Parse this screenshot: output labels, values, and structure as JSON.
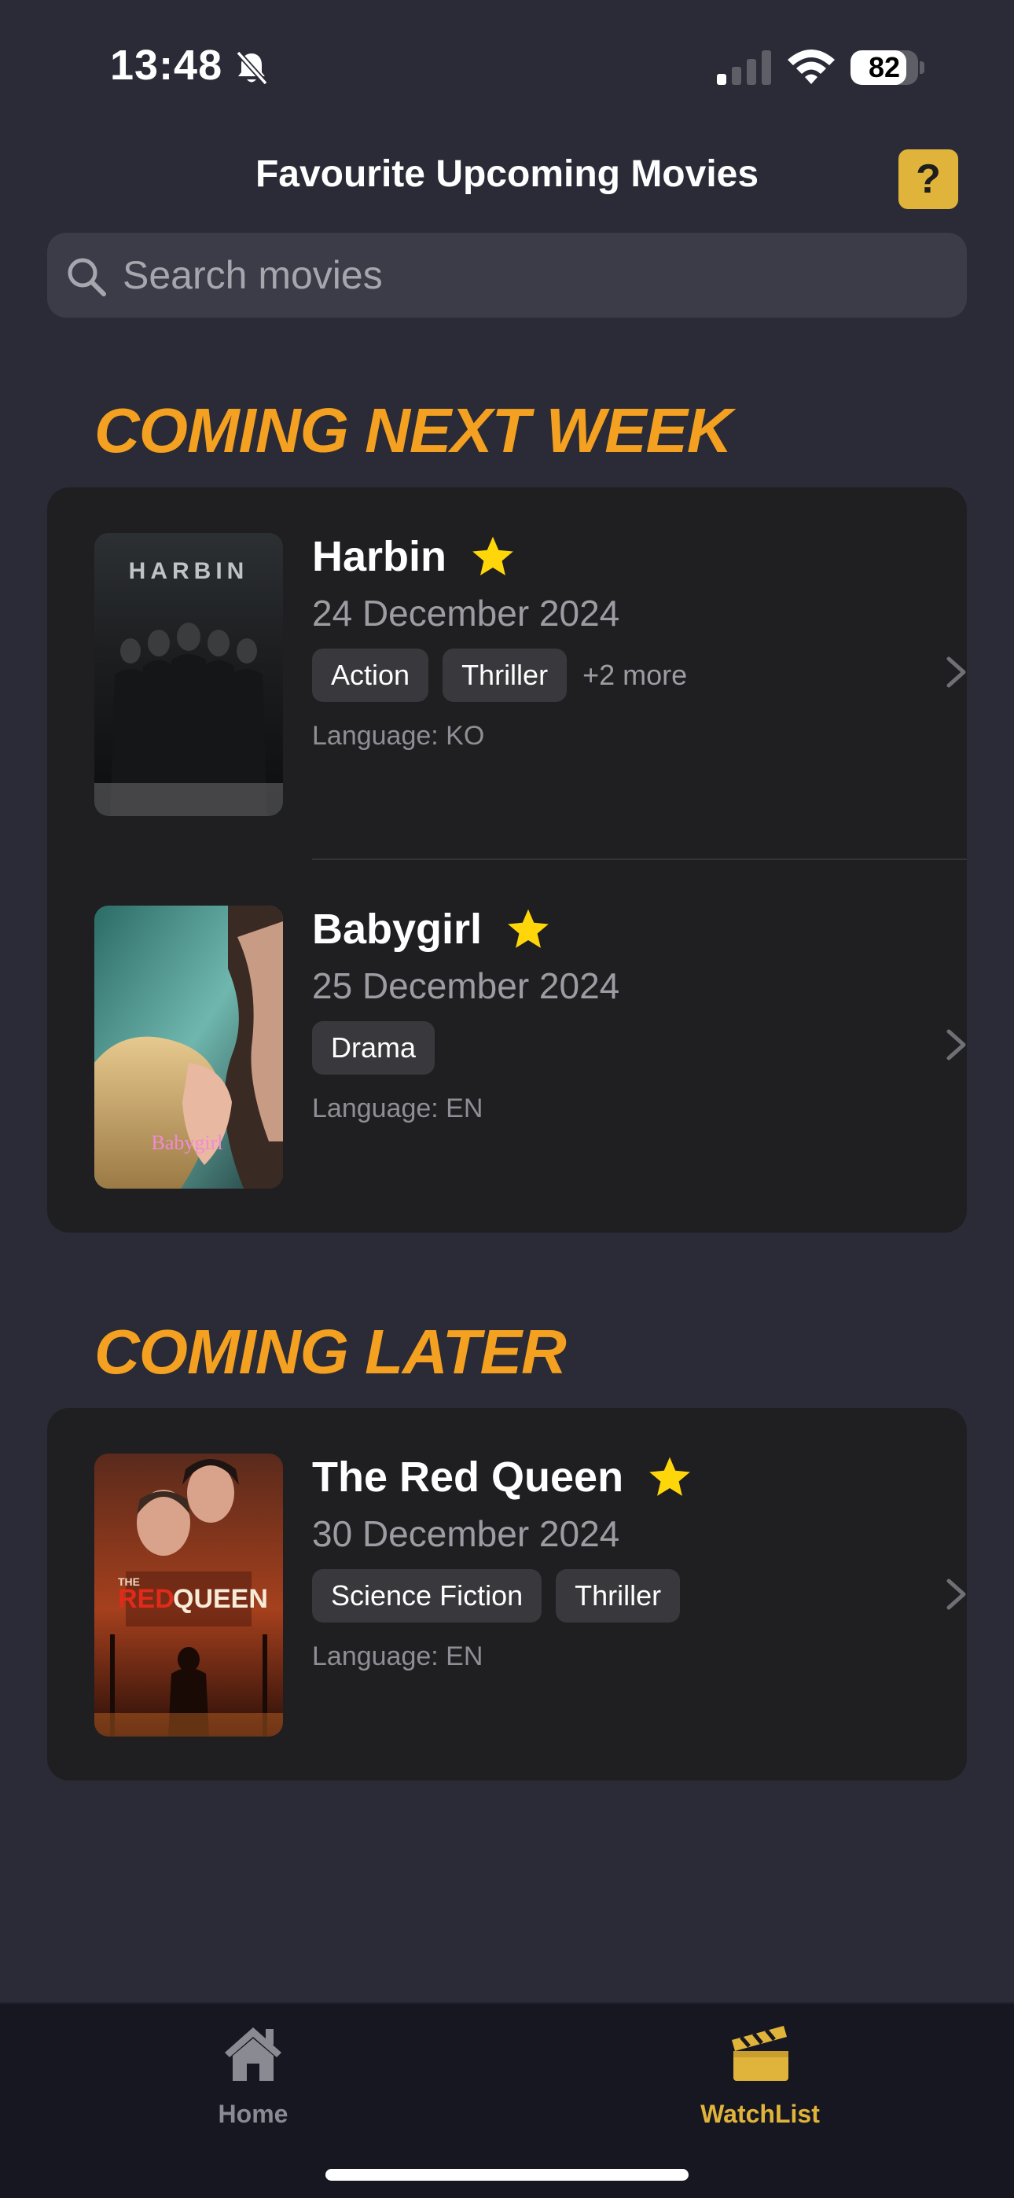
{
  "status_bar": {
    "time": "13:48",
    "battery_percent": "82",
    "battery_level": 0.82,
    "icons": [
      "bell-slash-icon",
      "cellular-signal-icon",
      "wifi-icon",
      "battery-icon"
    ]
  },
  "header": {
    "title": "Favourite Upcoming Movies",
    "help_label": "?"
  },
  "search": {
    "placeholder": "Search movies",
    "value": ""
  },
  "sections": [
    {
      "title": "COMING NEXT WEEK",
      "movies": [
        {
          "title": "Harbin",
          "date": "24 December 2024",
          "genres": [
            "Action",
            "Thriller"
          ],
          "more": "+2 more",
          "language": "Language: KO",
          "poster_text": "HARBIN",
          "favourite": true
        },
        {
          "title": "Babygirl",
          "date": "25 December 2024",
          "genres": [
            "Drama"
          ],
          "language": "Language: EN",
          "poster_text": "Babygirl",
          "favourite": true
        }
      ]
    },
    {
      "title": "COMING LATER",
      "movies": [
        {
          "title": "The Red Queen",
          "date": "30 December 2024",
          "genres": [
            "Science Fiction",
            "Thriller"
          ],
          "language": "Language: EN",
          "poster_text_1": "THE",
          "poster_text_2": "RED",
          "poster_text_3": "QUEEN",
          "favourite": true
        }
      ]
    }
  ],
  "tab_bar": {
    "home_label": "Home",
    "watchlist_label": "WatchList",
    "active": "WatchList"
  },
  "colors": {
    "background": "#2a2b37",
    "card": "#1f1f22",
    "accent_orange": "#f4a020",
    "accent_gold": "#e0b43a",
    "star": "#ffd60a"
  }
}
